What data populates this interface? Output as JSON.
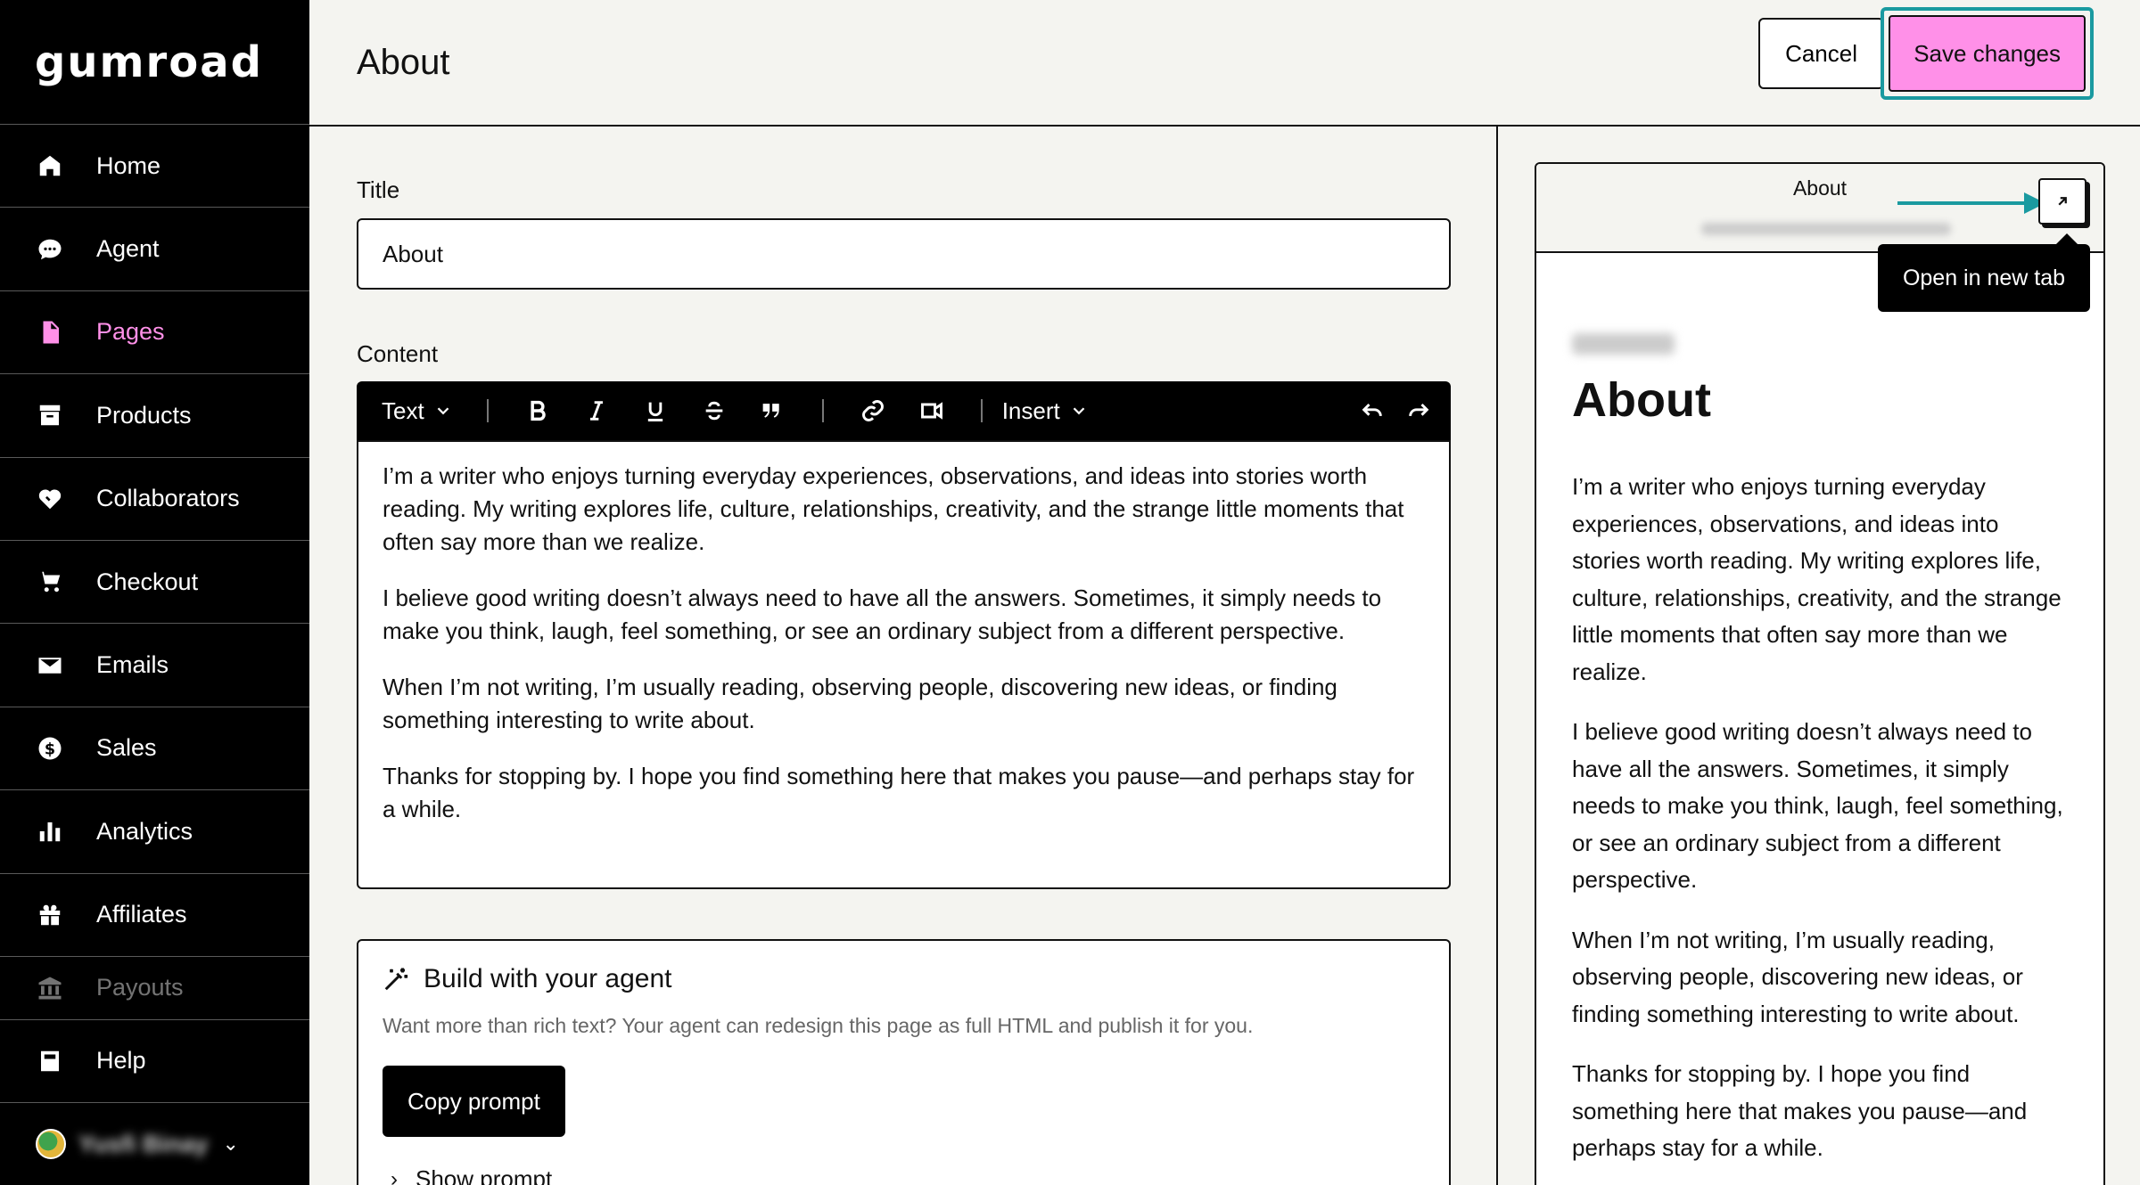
{
  "app": {
    "logo_text": "gumroad",
    "brand_color": "#ff90e8",
    "highlight_color": "#1a9aa0"
  },
  "sidebar": {
    "items": [
      {
        "label": "Home",
        "icon": "home-icon"
      },
      {
        "label": "Agent",
        "icon": "chat-bubble-icon"
      },
      {
        "label": "Pages",
        "icon": "document-icon",
        "active": true
      },
      {
        "label": "Products",
        "icon": "archive-box-icon"
      },
      {
        "label": "Collaborators",
        "icon": "handshake-heart-icon"
      },
      {
        "label": "Checkout",
        "icon": "cart-icon"
      },
      {
        "label": "Emails",
        "icon": "envelope-icon"
      },
      {
        "label": "Sales",
        "icon": "dollar-circle-icon"
      },
      {
        "label": "Analytics",
        "icon": "bar-chart-icon"
      },
      {
        "label": "Affiliates",
        "icon": "gift-icon"
      },
      {
        "label": "Payouts",
        "icon": "bank-icon"
      }
    ],
    "help_label": "Help",
    "account_name": "Yusfi Binay"
  },
  "header": {
    "title": "About",
    "cancel_label": "Cancel",
    "save_label": "Save changes"
  },
  "editor": {
    "title_label": "Title",
    "title_value": "About",
    "content_label": "Content",
    "toolbar": {
      "text_style": "Text",
      "insert_label": "Insert"
    },
    "paragraphs": [
      "I’m a writer who enjoys turning everyday experiences, observations, and ideas into stories worth reading. My writing explores life, culture, relationships, creativity, and the strange little moments that often say more than we realize.",
      "I believe good writing doesn’t always need to have all the answers. Sometimes, it simply needs to make you think, laugh, feel something, or see an ordinary subject from a different perspective.",
      "When I’m not writing, I’m usually reading, observing people, discovering new ideas, or finding something interesting to write about.",
      "Thanks for stopping by. I hope you find something here that makes you pause—and perhaps stay for a while."
    ]
  },
  "agent_card": {
    "title": "Build with your agent",
    "description": "Want more than rich text? Your agent can redesign this page as full HTML and publish it for you.",
    "copy_label": "Copy prompt",
    "show_label": "Show prompt"
  },
  "preview": {
    "bar_title": "About",
    "url": "yusfi.gumroad.com/l/socialwriter",
    "tooltip": "Open in new tab",
    "author": "Yusfi Binay",
    "heading": "About",
    "paragraphs": [
      "I’m a writer who enjoys turning everyday experiences, observations, and ideas into stories worth reading. My writing explores life, culture, relationships, creativity, and the strange little moments that often say more than we realize.",
      "I believe good writing doesn’t always need to have all the answers. Sometimes, it simply needs to make you think, laugh, feel something, or see an ordinary subject from a different perspective.",
      "When I’m not writing, I’m usually reading, observing people, discovering new ideas, or finding something interesting to write about.",
      "Thanks for stopping by. I hope you find something here that makes you pause—and perhaps stay for a while."
    ]
  }
}
